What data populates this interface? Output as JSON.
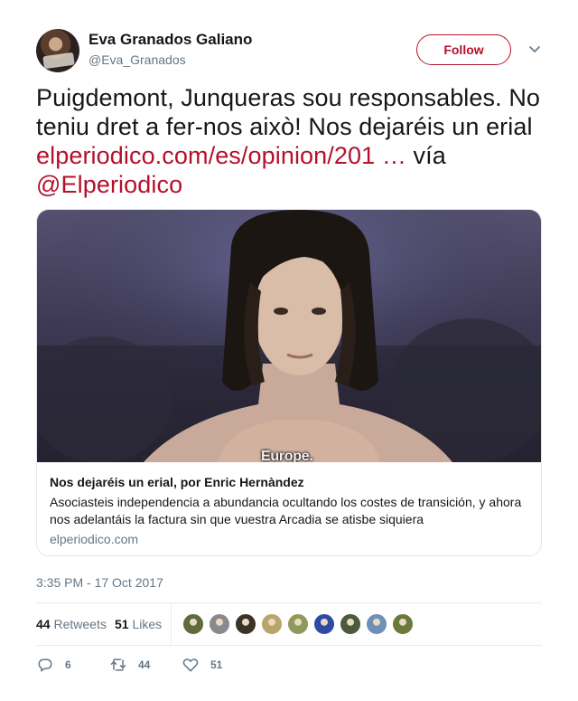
{
  "author": {
    "name": "Eva Granados Galiano",
    "handle": "@Eva_Granados"
  },
  "follow_label": "Follow",
  "tweet": {
    "text_lead": "Puigdemont, Junqueras sou responsables. No teniu dret a fer-nos això! Nos dejaréis un erial ",
    "link_text": "elperiodico.com/es/opinion/201",
    "ellipsis": " …",
    "via_text": " vía ",
    "mention": "@Elperiodico"
  },
  "card": {
    "image_caption": "Europe.",
    "title": "Nos dejaréis un erial, por Enric Hernàndez",
    "description": "Asociasteis independencia a abundancia ocultando los costes de transición, y ahora nos adelantáis la factura sin que vuestra Arcadia se atisbe siquiera",
    "domain": "elperiodico.com"
  },
  "timestamp": "3:35 PM - 17 Oct 2017",
  "stats": {
    "retweets_count": "44",
    "retweets_label": "Retweets",
    "likes_count": "51",
    "likes_label": "Likes"
  },
  "liker_avatar_colors": [
    "#5e6b3a",
    "#8a8a8a",
    "#3b3325",
    "#b9a46a",
    "#8f9a5a",
    "#2f4aa3",
    "#4a5a3a",
    "#6f8fb8",
    "#6a7a3a"
  ],
  "actions": {
    "reply_count": "6",
    "retweet_count": "44",
    "like_count": "51"
  },
  "colors": {
    "accent": "#b5102b",
    "muted": "#657786",
    "text": "#14171a"
  },
  "icons": [
    "chevron-down-icon",
    "reply-icon",
    "retweet-icon",
    "heart-icon"
  ]
}
